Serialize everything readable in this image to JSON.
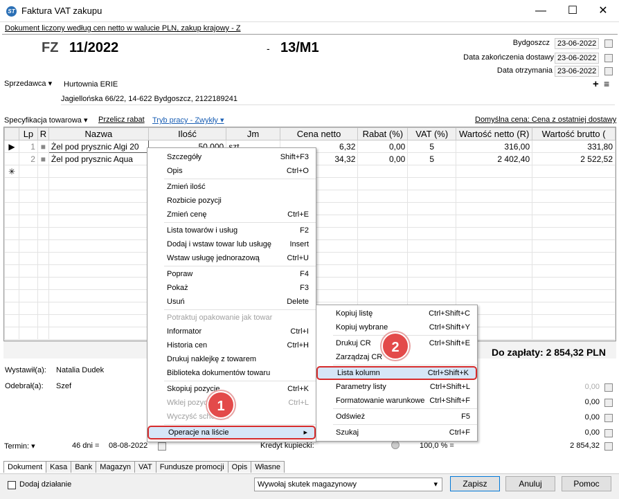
{
  "window": {
    "title": "Faktura VAT zakupu",
    "minimize": "—",
    "maximize": "☐",
    "close": "✕",
    "subheader": "Dokument liczony według cen netto w walucie PLN, zakup krajowy - Z"
  },
  "doc": {
    "prefix": "FZ",
    "number": "11/2022",
    "dash": "-",
    "number2": "13/M1"
  },
  "dates": {
    "place": "Bydgoszcz",
    "date1": "23-06-2022",
    "label2": "Data zakończenia dostawy",
    "date2": "23-06-2022",
    "label3": "Data otrzymania",
    "date3": "23-06-2022"
  },
  "seller": {
    "label": "Sprzedawca",
    "name": "Hurtownia ERIE",
    "address": "Jagiellońska 66/22, 14-622 Bydgoszcz, 2122189241",
    "add": "+",
    "list": "≡"
  },
  "spec": {
    "label": "Specyfikacja towarowa",
    "recalc": "Przelicz rabat",
    "mode": "Tryb pracy - Zwykły",
    "default_price": "Domyślna cena: Cena z ostatniej dostawy"
  },
  "grid": {
    "headers": [
      "",
      "Lp",
      "R",
      "Nazwa",
      "Ilość",
      "Jm",
      "Cena netto",
      "Rabat (%)",
      "VAT (%)",
      "Wartość netto (R)",
      "Wartość brutto ("
    ],
    "rows": [
      {
        "marker": "▶",
        "lp": "1",
        "r": "■",
        "name": "Żel pod prysznic Algi 20",
        "qty": "50,000",
        "unit": "szt.",
        "price": "6,32",
        "rabat": "0,00",
        "vat": "5",
        "netto": "316,00",
        "brutto": "331,80"
      },
      {
        "marker": "",
        "lp": "2",
        "r": "■",
        "name": "Żel pod prysznic Aqua",
        "qty": "",
        "unit": "",
        "price": "34,32",
        "rabat": "0,00",
        "vat": "5",
        "netto": "2 402,40",
        "brutto": "2 522,52"
      },
      {
        "marker": "✳",
        "lp": "",
        "r": "",
        "name": "",
        "qty": "",
        "unit": "",
        "price": "",
        "rabat": "",
        "vat": "",
        "netto": "",
        "brutto": ""
      }
    ]
  },
  "total": "Do zapłaty: 2 854,32 PLN",
  "people": {
    "issued_label": "Wystawił(a):",
    "issued": "Natalia Dudek",
    "received_label": "Odebrał(a):",
    "received": "Szef"
  },
  "values": {
    "v1": "0,00",
    "v2": "0,00",
    "v3": "0,00",
    "v4": "0,00",
    "total": "2 854,32"
  },
  "term": {
    "label": "Termin:",
    "days": "46 dni =",
    "date": "08-08-2022",
    "credit": "Kredyt kupiecki:",
    "percent": "100,0 % ="
  },
  "context_menu": [
    {
      "label": "Szczegóły",
      "shortcut": "Shift+F3"
    },
    {
      "label": "Opis",
      "shortcut": "Ctrl+O"
    },
    {
      "sep": true
    },
    {
      "label": "Zmień ilość",
      "shortcut": ""
    },
    {
      "label": "Rozbicie pozycji",
      "shortcut": ""
    },
    {
      "label": "Zmień cenę",
      "shortcut": "Ctrl+E"
    },
    {
      "sep": true
    },
    {
      "label": "Lista towarów i usług",
      "shortcut": "F2"
    },
    {
      "label": "Dodaj i wstaw towar lub usługę",
      "shortcut": "Insert"
    },
    {
      "label": "Wstaw usługę jednorazową",
      "shortcut": "Ctrl+U"
    },
    {
      "sep": true
    },
    {
      "label": "Popraw",
      "shortcut": "F4"
    },
    {
      "label": "Pokaż",
      "shortcut": "F3"
    },
    {
      "label": "Usuń",
      "shortcut": "Delete"
    },
    {
      "sep": true
    },
    {
      "label": "Potraktuj opakowanie jak towar",
      "shortcut": "",
      "disabled": true
    },
    {
      "label": "Informator",
      "shortcut": "Ctrl+I"
    },
    {
      "label": "Historia cen",
      "shortcut": "Ctrl+H"
    },
    {
      "label": "Drukuj naklejkę z towarem",
      "shortcut": ""
    },
    {
      "label": "Biblioteka dokumentów towaru",
      "shortcut": ""
    },
    {
      "sep": true
    },
    {
      "label": "Skopiuj pozycje",
      "shortcut": "Ctrl+K"
    },
    {
      "label": "Wklej pozycje",
      "shortcut": "Ctrl+L",
      "disabled": true
    },
    {
      "label": "Wyczyść schowek",
      "shortcut": "",
      "disabled": true
    },
    {
      "sep": true
    },
    {
      "label": "Operacje na liście",
      "shortcut": "▸",
      "highlight": true
    }
  ],
  "submenu": [
    {
      "label": "Kopiuj listę",
      "shortcut": "Ctrl+Shift+C"
    },
    {
      "label": "Kopiuj wybrane",
      "shortcut": "Ctrl+Shift+Y"
    },
    {
      "sep": true
    },
    {
      "label": "Drukuj CR",
      "shortcut": "Ctrl+Shift+E"
    },
    {
      "label": "Zarządzaj CR",
      "shortcut": ""
    },
    {
      "sep": true
    },
    {
      "label": "Lista kolumn",
      "shortcut": "Ctrl+Shift+K",
      "highlight": true
    },
    {
      "label": "Parametry listy",
      "shortcut": "Ctrl+Shift+L"
    },
    {
      "label": "Formatowanie warunkowe",
      "shortcut": "Ctrl+Shift+F"
    },
    {
      "sep": true
    },
    {
      "label": "Odśwież",
      "shortcut": "F5"
    },
    {
      "sep": true
    },
    {
      "label": "Szukaj",
      "shortcut": "Ctrl+F"
    }
  ],
  "badges": {
    "one": "1",
    "two": "2"
  },
  "tabs": [
    "Dokument",
    "Kasa",
    "Bank",
    "Magazyn",
    "VAT",
    "Fundusze promocji",
    "Opis",
    "Własne"
  ],
  "footer": {
    "checkbox_label": "Dodaj działanie",
    "combo": "Wywołaj skutek magazynowy",
    "save": "Zapisz",
    "cancel": "Anuluj",
    "help": "Pomoc"
  },
  "colors": {
    "accent": "#1a5fb4",
    "highlight_border": "#d62b2b",
    "badge": "#e34a4a"
  }
}
